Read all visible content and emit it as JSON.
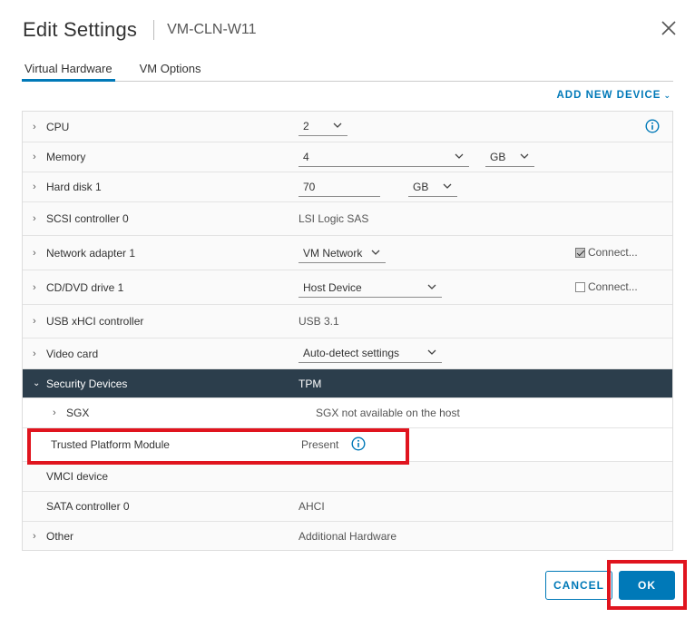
{
  "header": {
    "title": "Edit Settings",
    "vm_name": "VM-CLN-W11",
    "close_icon": "close-icon"
  },
  "tabs": [
    {
      "label": "Virtual Hardware",
      "active": true
    },
    {
      "label": "VM Options",
      "active": false
    }
  ],
  "add_new_device": "ADD NEW DEVICE",
  "rows": {
    "cpu": {
      "label": "CPU",
      "value": "2"
    },
    "memory": {
      "label": "Memory",
      "value": "4",
      "unit": "GB"
    },
    "hard_disk": {
      "label": "Hard disk 1",
      "value": "70",
      "unit": "GB"
    },
    "scsi": {
      "label": "SCSI controller 0",
      "value": "LSI Logic SAS"
    },
    "network": {
      "label": "Network adapter 1",
      "value": "VM Network",
      "connect_label": "Connect...",
      "connect_checked": true
    },
    "cddvd": {
      "label": "CD/DVD drive 1",
      "value": "Host Device",
      "connect_label": "Connect...",
      "connect_checked": false
    },
    "usb": {
      "label": "USB xHCI controller",
      "value": "USB 3.1"
    },
    "video": {
      "label": "Video card",
      "value": "Auto-detect settings"
    },
    "security": {
      "label": "Security Devices",
      "value": "TPM"
    },
    "sgx": {
      "label": "SGX",
      "value": "SGX not available on the host"
    },
    "tpm": {
      "label": "Trusted Platform Module",
      "value": "Present"
    },
    "vmci": {
      "label": "VMCI device",
      "value": ""
    },
    "sata": {
      "label": "SATA controller 0",
      "value": "AHCI"
    },
    "other": {
      "label": "Other",
      "value": "Additional Hardware"
    }
  },
  "footer": {
    "cancel_label": "CANCEL",
    "ok_label": "OK"
  },
  "colors": {
    "accent": "#0079b8",
    "header_row": "#2c3e4c",
    "highlight": "#e0141e"
  }
}
